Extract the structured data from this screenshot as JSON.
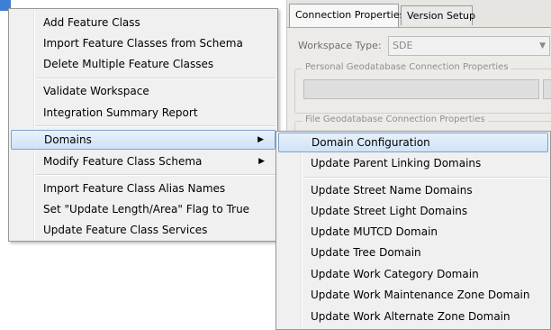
{
  "background": {
    "tabs": [
      "Connection Properties",
      "Version Setup"
    ],
    "workspace_type_label": "Workspace Type:",
    "workspace_type_value": "SDE",
    "group_personal_title": "Personal Geodatabase Connection Properties",
    "group_file_title": "File Geodatabase Connection Properties"
  },
  "main_menu": {
    "items": [
      "Add Feature Class",
      "Import Feature Classes from Schema",
      "Delete Multiple Feature Classes",
      "Validate Workspace",
      "Integration Summary Report",
      "Domains",
      "Modify Feature Class Schema",
      "Import Feature Class Alias Names",
      "Set \"Update Length/Area\" Flag to True",
      "Update Feature Class Services"
    ]
  },
  "sub_menu": {
    "items": [
      "Domain Configuration",
      "Update Parent Linking Domains",
      "Update Street Name Domains",
      "Update Street Light Domains",
      "Update MUTCD Domain",
      "Update Tree Domain",
      "Update Work Category Domain",
      "Update Work Maintenance Zone Domain",
      "Update Work Alternate Zone Domain"
    ]
  },
  "icons": {
    "submenu_arrow": "▶",
    "dropdown_arrow": "▼"
  }
}
